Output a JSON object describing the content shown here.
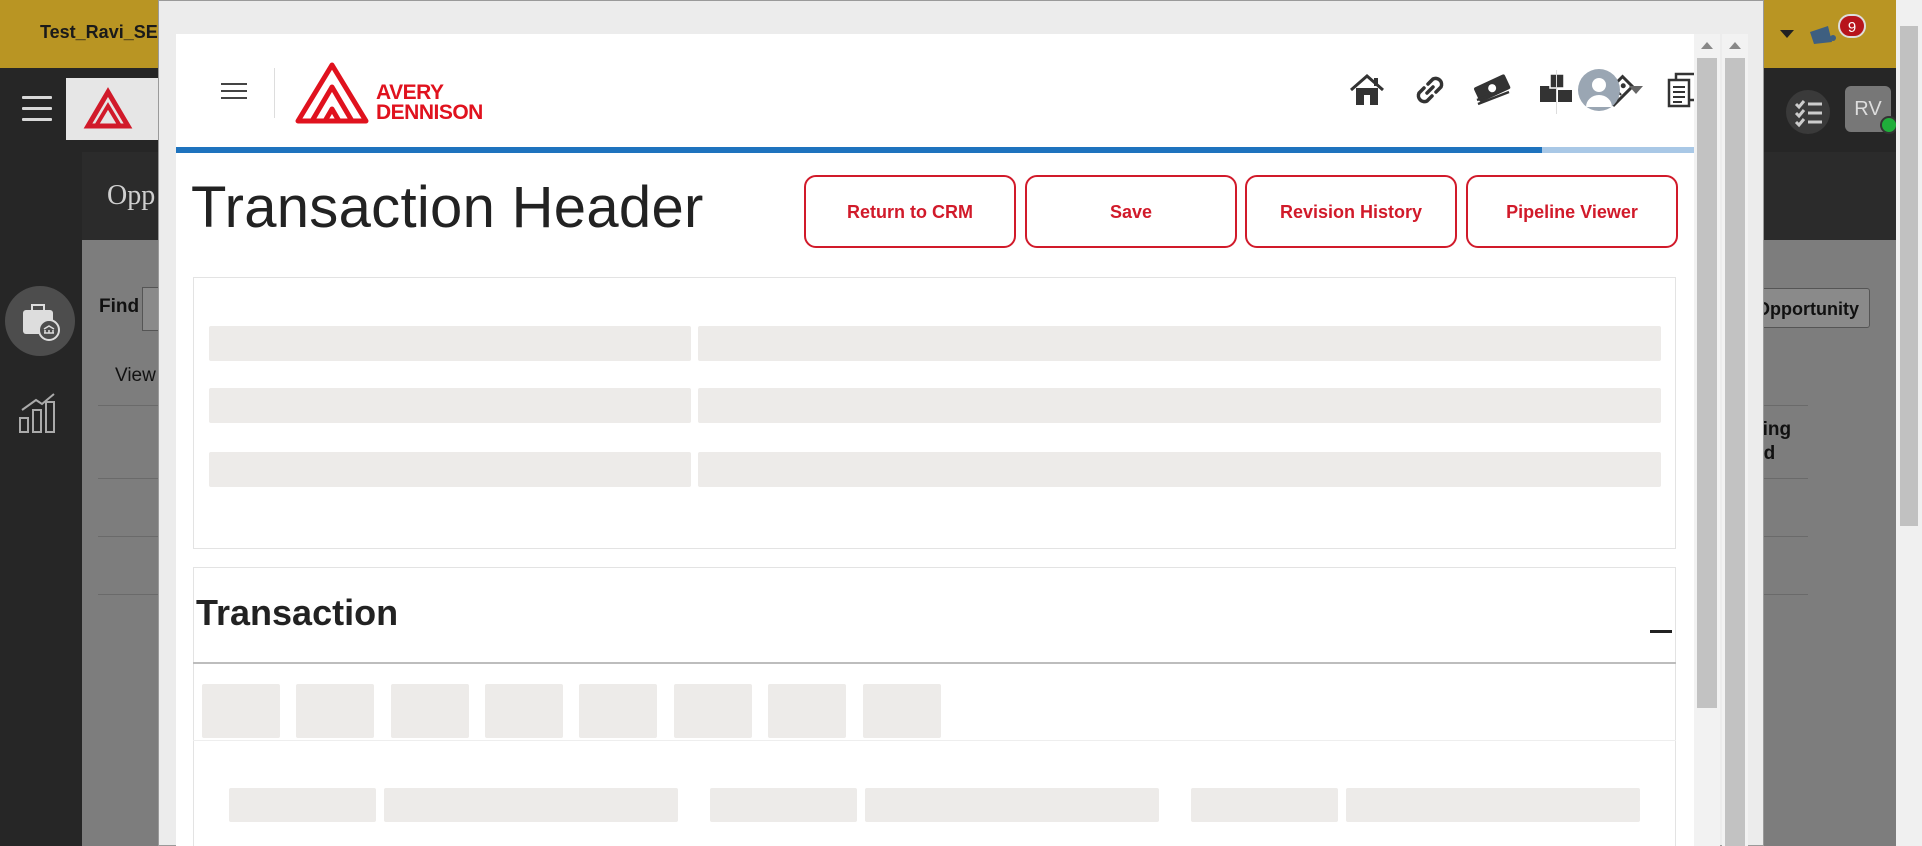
{
  "background": {
    "user_label": "Test_Ravi_SE",
    "page_title": "Opp",
    "find_label": "Find",
    "view_label": "View",
    "new_button_label": "Opportunity",
    "column_header": "cing\nod",
    "avatar_initials": "RV",
    "notification_count": "9"
  },
  "modal": {
    "logo_text_line1": "AVERY",
    "logo_text_line2": "DENNISON",
    "nav_icons": [
      "home-icon",
      "link-icon",
      "money-icon",
      "products-icon",
      "tag-icon",
      "documents-icon"
    ],
    "progress_percent": 90,
    "page_title": "Transaction Header",
    "buttons": {
      "return_to_crm": "Return to CRM",
      "save": "Save",
      "revision_history": "Revision History",
      "pipeline_viewer": "Pipeline Viewer"
    },
    "section_title": "Transaction",
    "colors": {
      "brand_red": "#d11a2a",
      "progress_blue": "#1e73be",
      "skeleton_gray": "#edebe9"
    }
  }
}
